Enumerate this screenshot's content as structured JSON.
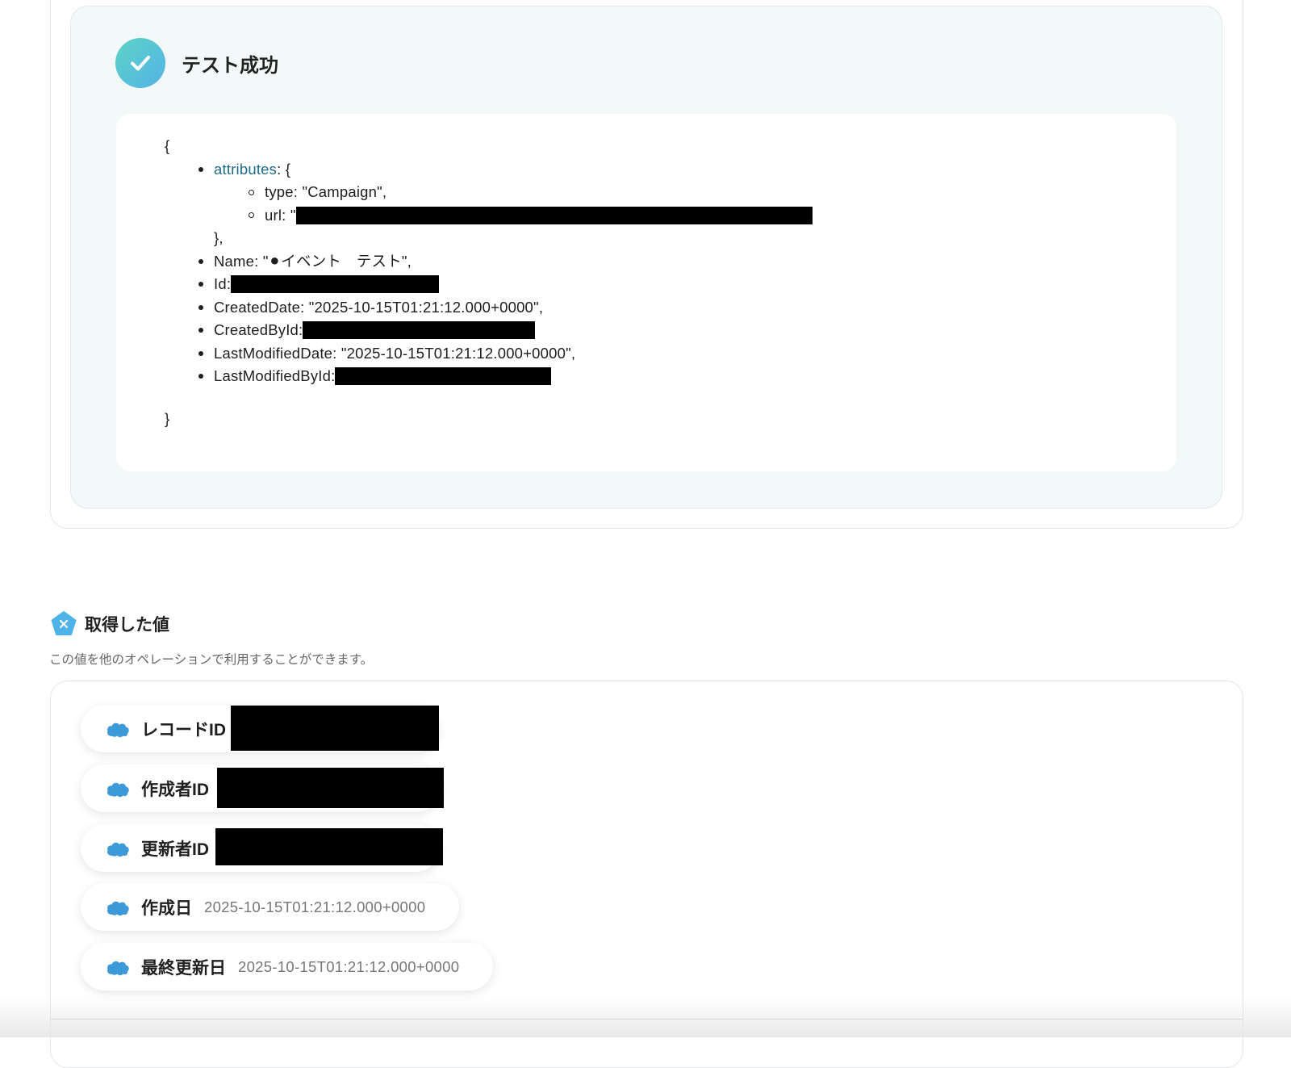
{
  "test_result": {
    "title": "テスト成功",
    "icon": "check-icon",
    "json": {
      "open_brace": "{",
      "close_brace": "}",
      "attributes_key": "attributes",
      "attributes_open": ": {",
      "attributes_close": "},",
      "type_line": "type: \"Campaign\",",
      "url_prefix": "url: \"",
      "name_line": "Name: \"⚫イベント　テスト\",",
      "id_prefix": "Id: ",
      "created_date_line": "CreatedDate: \"2025-10-15T01:21:12.000+0000\",",
      "created_by_prefix": "CreatedById: ",
      "last_modified_date_line": "LastModifiedDate: \"2025-10-15T01:21:12.000+0000\",",
      "last_modified_by_prefix": "LastModifiedById: "
    }
  },
  "acquired_values": {
    "title": "取得した値",
    "description": "この値を他のオペレーションで利用することができます。",
    "items": [
      {
        "label": "レコードID",
        "value": "",
        "redacted": true
      },
      {
        "label": "作成者ID",
        "value": "",
        "redacted": true
      },
      {
        "label": "更新者ID",
        "value": "",
        "redacted": true
      },
      {
        "label": "作成日",
        "value": "2025-10-15T01:21:12.000+0000",
        "redacted": false
      },
      {
        "label": "最終更新日",
        "value": "2025-10-15T01:21:12.000+0000",
        "redacted": false
      }
    ]
  },
  "colors": {
    "accent_teal": "#5ed3c7",
    "accent_blue": "#53b3e6",
    "salesforce_blue": "#3d9ad9",
    "link": "#1d6b86"
  }
}
